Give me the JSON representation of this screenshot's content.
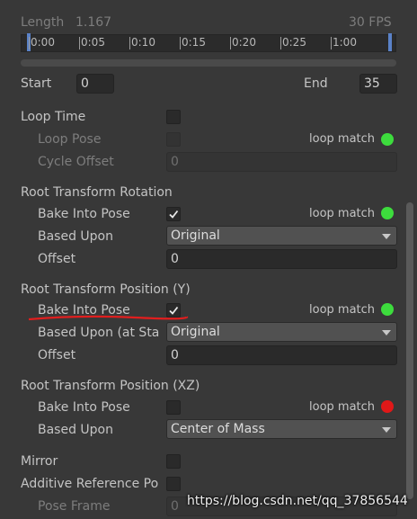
{
  "header": {
    "length_label": "Length",
    "length_value": "1.167",
    "fps": "30 FPS"
  },
  "timeline": {
    "ticks": [
      "0:00",
      "0:05",
      "0:10",
      "0:15",
      "0:20",
      "0:25",
      "1:00"
    ]
  },
  "range": {
    "start_label": "Start",
    "start_value": "0",
    "end_label": "End",
    "end_value": "35"
  },
  "loop_time": {
    "label": "Loop Time",
    "checked": false,
    "loop_pose_label": "Loop Pose",
    "loop_match": "loop match",
    "loop_match_color": "#3ddc3d",
    "cycle_offset_label": "Cycle Offset",
    "cycle_offset_value": "0"
  },
  "rotation": {
    "title": "Root Transform Rotation",
    "bake_label": "Bake Into Pose",
    "bake_checked": true,
    "loop_match": "loop match",
    "loop_match_color": "#3ddc3d",
    "based_upon_label": "Based Upon",
    "based_upon_value": "Original",
    "offset_label": "Offset",
    "offset_value": "0"
  },
  "position_y": {
    "title": "Root Transform Position (Y)",
    "bake_label": "Bake Into Pose",
    "bake_checked": true,
    "loop_match": "loop match",
    "loop_match_color": "#3ddc3d",
    "based_upon_label": "Based Upon (at Sta",
    "based_upon_value": "Original",
    "offset_label": "Offset",
    "offset_value": "0",
    "annotation_color": "#e01e1e"
  },
  "position_xz": {
    "title": "Root Transform Position (XZ)",
    "bake_label": "Bake Into Pose",
    "bake_checked": false,
    "loop_match": "loop match",
    "loop_match_color": "#e01818",
    "based_upon_label": "Based Upon",
    "based_upon_value": "Center of Mass"
  },
  "mirror": {
    "label": "Mirror",
    "checked": false
  },
  "additive": {
    "label": "Additive Reference Po",
    "checked": false,
    "pose_frame_label": "Pose Frame",
    "pose_frame_value": "0"
  },
  "watermark": {
    "text": "https://blog.csdn.net/qq_37856544"
  }
}
